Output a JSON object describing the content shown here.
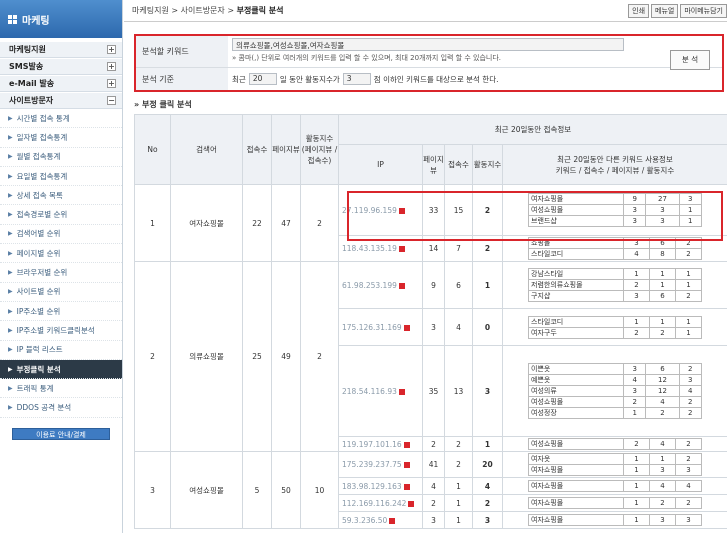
{
  "sidebar": {
    "title": "마케팅",
    "sections": [
      "마케팅지원",
      "SMS발송",
      "e-Mail 발송",
      "사이트방문자"
    ],
    "items": [
      "시간별 접속 통계",
      "일자별 접속통계",
      "월별 접속통계",
      "요일별 접속통계",
      "상세 접속 목록",
      "접속경로별 순위",
      "검색어별 순위",
      "페이지별 순위",
      "브라우저별 순위",
      "사이트별 순위",
      "IP주소별 순위",
      "IP주소별 키워드클릭분석",
      "IP 블럭 리스트",
      "부정클릭 분석",
      "트래픽 통계",
      "DDOS 공격 분석"
    ],
    "active_item": "부정클릭 분석",
    "button": "이용료 안내/결제"
  },
  "breadcrumb": [
    "마케팅지원",
    "사이트방문자",
    "부정클릭 분석"
  ],
  "top_buttons": [
    "인쇄",
    "메뉴얼",
    "마이메뉴담기"
  ],
  "search": {
    "keyword_label": "분석할 키워드",
    "keyword_value": "의류쇼핑몰,여성쇼핑몰,여자쇼핑몰",
    "hint": "» 콤마(,) 단위로 여러개의 키워드를 입력 할 수 있으며, 최대 20개까지 입력 할 수 있습니다.",
    "criteria_label": "분석 기준",
    "criteria_pre": "최근",
    "days": "20",
    "criteria_mid": "일 동안 활동지수가",
    "threshold": "3",
    "criteria_post": "점 이하인 키워드를 대상으로 분석 한다.",
    "button": "분 석"
  },
  "section_title": "» 부정 클릭 분석",
  "table": {
    "headers": {
      "no": "No",
      "keyword": "검색어",
      "visits": "접속수",
      "pageviews": "페이지뷰",
      "activity": "활동지수 (페이지뷰 / 접속수)",
      "recent": "최근 20일동안 접속정보",
      "ip": "IP",
      "pv": "페이지뷰",
      "vc": "접속수",
      "act": "활동지수",
      "other": "최근 20일동안 다른 키워드 사용정보",
      "other_sub": "키워드 / 접속수 / 페이지뷰 / 활동지수"
    },
    "rows": [
      {
        "no": "1",
        "keyword": "여자쇼핑몰",
        "visits": "22",
        "pageviews": "47",
        "activity": "2",
        "ips": [
          {
            "ip": "27.119.96.159",
            "pv": "33",
            "vc": "15",
            "act": "2",
            "kws": [
              [
                "여자쇼핑몰",
                "9",
                "27",
                "3"
              ],
              [
                "여성쇼핑몰",
                "3",
                "3",
                "1"
              ],
              [
                "브랜드샵",
                "3",
                "3",
                "1"
              ]
            ]
          },
          {
            "ip": "118.43.135.19",
            "pv": "14",
            "vc": "7",
            "act": "2",
            "kws": [
              [
                "쇼핑몰",
                "3",
                "6",
                "2"
              ],
              [
                "스타일코디",
                "4",
                "8",
                "2"
              ]
            ]
          }
        ]
      },
      {
        "no": "2",
        "keyword": "의류쇼핑몰",
        "visits": "25",
        "pageviews": "49",
        "activity": "2",
        "ips": [
          {
            "ip": "61.98.253.199",
            "pv": "9",
            "vc": "6",
            "act": "1",
            "kws": [
              [
                "강남스타일",
                "1",
                "1",
                "1"
              ],
              [
                "저렴한의류쇼핑몰",
                "2",
                "1",
                "1"
              ],
              [
                "구지샵",
                "3",
                "6",
                "2"
              ]
            ]
          },
          {
            "ip": "175.126.31.169",
            "pv": "3",
            "vc": "4",
            "act": "0",
            "kws": [
              [
                "스타일코디",
                "1",
                "1",
                "1"
              ],
              [
                "여자구두",
                "2",
                "2",
                "1"
              ]
            ]
          },
          {
            "ip": "218.54.116.93",
            "pv": "35",
            "vc": "13",
            "act": "3",
            "kws": [
              [
                "이쁜옷",
                "3",
                "6",
                "2"
              ],
              [
                "예쁜옷",
                "4",
                "12",
                "3"
              ],
              [
                "여성의류",
                "3",
                "12",
                "4"
              ],
              [
                "여성쇼핑몰",
                "2",
                "4",
                "2"
              ],
              [
                "여성정장",
                "1",
                "2",
                "2"
              ]
            ]
          },
          {
            "ip": "119.197.101.16",
            "pv": "2",
            "vc": "2",
            "act": "1",
            "kws": [
              [
                "여성쇼핑몰",
                "2",
                "4",
                "2"
              ]
            ]
          }
        ]
      },
      {
        "no": "3",
        "keyword": "여성쇼핑몰",
        "visits": "5",
        "pageviews": "50",
        "activity": "10",
        "ips": [
          {
            "ip": "175.239.237.75",
            "pv": "41",
            "vc": "2",
            "act": "20",
            "kws": [
              [
                "여자옷",
                "1",
                "1",
                "2"
              ],
              [
                "여자쇼핑몰",
                "1",
                "3",
                "3"
              ]
            ]
          },
          {
            "ip": "183.98.129.163",
            "pv": "4",
            "vc": "1",
            "act": "4",
            "kws": [
              [
                "여자쇼핑몰",
                "1",
                "4",
                "4"
              ]
            ]
          },
          {
            "ip": "112.169.116.242",
            "pv": "2",
            "vc": "1",
            "act": "2",
            "kws": [
              [
                "여자쇼핑몰",
                "1",
                "2",
                "2"
              ]
            ]
          },
          {
            "ip": "59.3.236.50",
            "pv": "3",
            "vc": "1",
            "act": "3",
            "kws": [
              [
                "여자쇼핑몰",
                "1",
                "3",
                "3"
              ]
            ]
          }
        ]
      }
    ]
  }
}
